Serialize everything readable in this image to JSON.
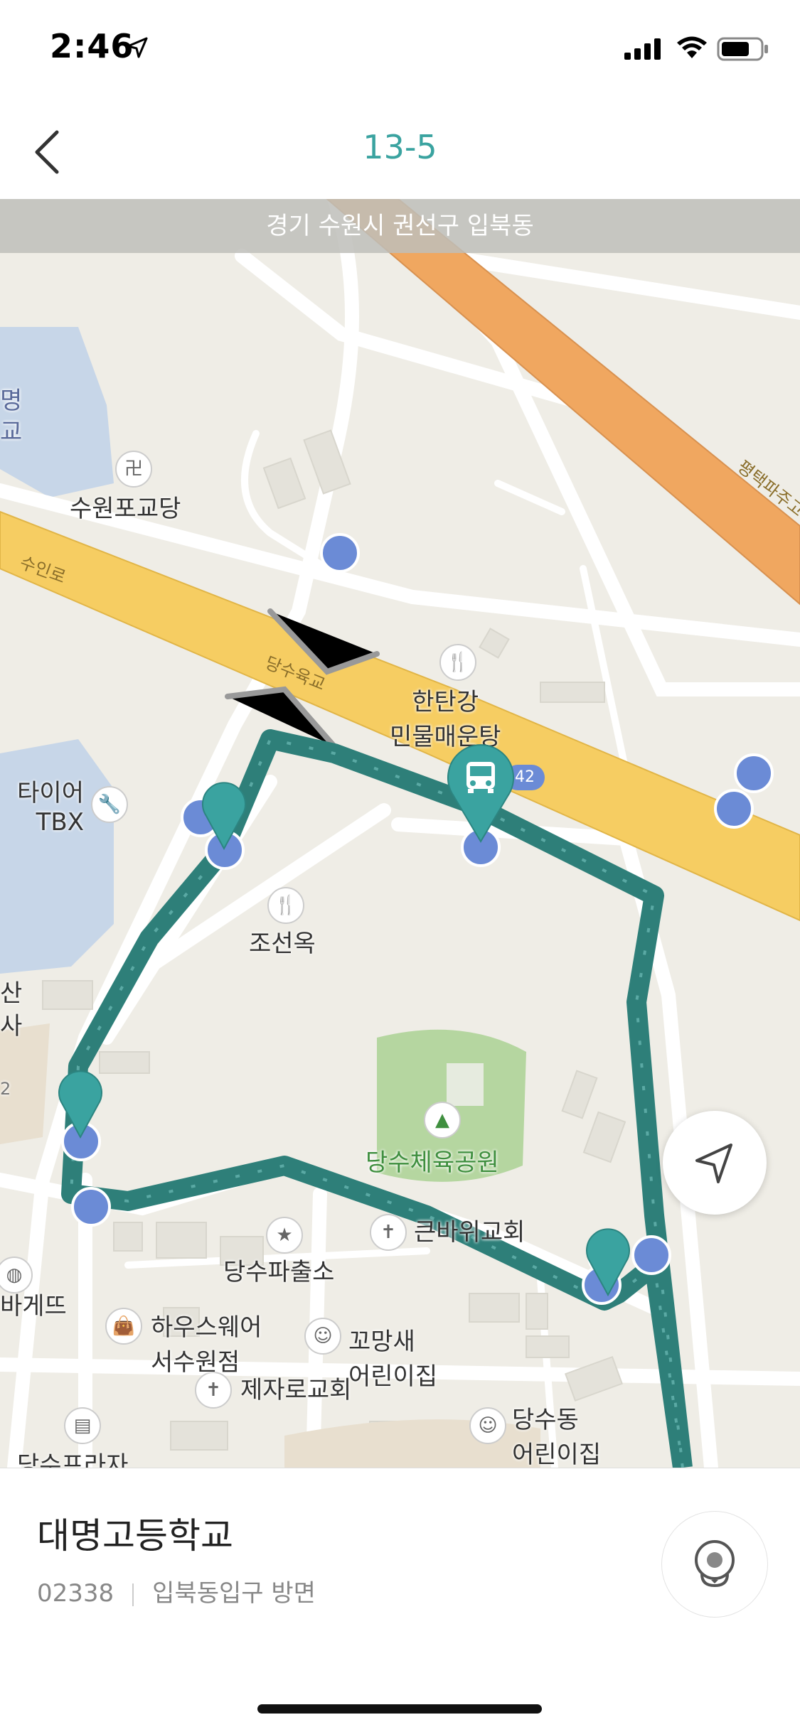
{
  "status_bar": {
    "time": "2:46"
  },
  "header": {
    "title": "13-5"
  },
  "map": {
    "address_banner": "경기 수원시 권선구 입북동",
    "roads": {
      "suin_ro": "수인로",
      "dangsu_bridge": "당수육교",
      "pyeongtaek_expressway": "평택파주고"
    },
    "places": {
      "suwon_pogyodang": "수원포교당",
      "hantangang_line1": "한탄강",
      "hantangang_line2": "민물매운탕",
      "tire_line1": "타이어",
      "tire_line2": "TBX",
      "joseonok": "조선옥",
      "dangsu_park": "당수체육공원",
      "keunbawi_church": "큰바위교회",
      "dangsu_police": "당수파출소",
      "housewear_line1": "하우스웨어",
      "housewear_line2": "서수원점",
      "kkomangsae_line1": "꼬망새",
      "kkomangsae_line2": "어린이집",
      "jejaro_church": "제자로교회",
      "dangsudong_line1": "당수동",
      "dangsudong_line2": "어린이집",
      "bagette": "바게뜨",
      "dangsu_plaza": "당수프라자",
      "edge_left_1": "명",
      "edge_left_2": "교",
      "edge_left_3": "산",
      "edge_left_4": "사",
      "edge_left_5": "2",
      "bus_number_badge": "42"
    }
  },
  "stop": {
    "name": "대명고등학교",
    "id": "02338",
    "direction": "입북동입구 방면"
  },
  "colors": {
    "accent": "#3aa3a0",
    "route": "#2e7f79",
    "bus_stop": "#6b8bd6",
    "highway_yellow": "#f6cd62",
    "highway_orange": "#f0a760",
    "park": "#b5d6a0",
    "water": "#c7d6e8"
  }
}
